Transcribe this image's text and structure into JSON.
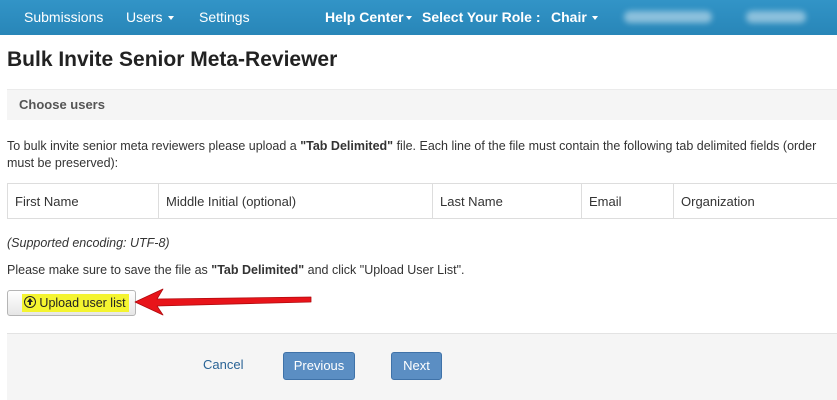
{
  "nav": {
    "submissions": "Submissions",
    "users": "Users",
    "settings": "Settings",
    "help_center": "Help Center",
    "select_role_label": "Select Your Role :",
    "role": "Chair"
  },
  "page_title": "Bulk Invite Senior Meta-Reviewer",
  "panel_heading": "Choose users",
  "instructions": {
    "before": "To bulk invite senior meta reviewers please upload a ",
    "bold": "\"Tab Delimited\"",
    "after": " file. Each line of the file must contain the following tab delimited fields (order must be preserved):"
  },
  "fields": [
    "First Name",
    "Middle Initial (optional)",
    "Last Name",
    "Email",
    "Organization"
  ],
  "encoding_note": "(Supported encoding: UTF-8)",
  "save_note": {
    "before": "Please make sure to save the file as ",
    "bold": "\"Tab Delimited\"",
    "after": " and click \"Upload User List\"."
  },
  "upload_button": {
    "icon": "circle-arrow-up-icon",
    "label": "Upload user list"
  },
  "footer": {
    "cancel": "Cancel",
    "previous": "Previous",
    "next": "Next"
  },
  "colors": {
    "navbar": "#2b8cbe",
    "primary_button": "#5b8ec3",
    "highlight": "#f4f430",
    "annotation_arrow": "#e8141a"
  }
}
